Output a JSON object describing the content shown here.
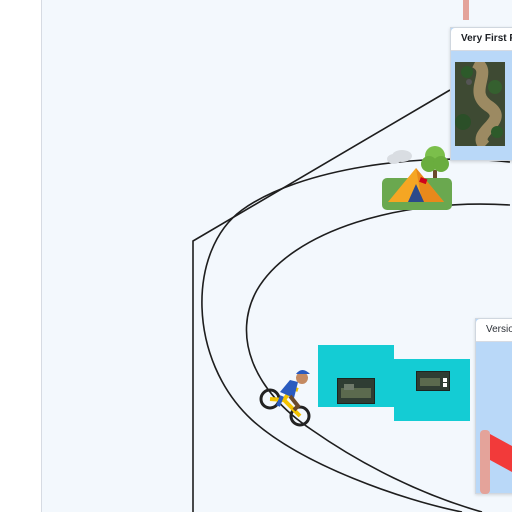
{
  "cards": [
    {
      "title": "Very First P"
    },
    {
      "title": "Versio"
    }
  ],
  "icons": {
    "tent": "camping-tent-icon",
    "cyclist": "mountain-biker-icon",
    "flag": "red-flag-icon",
    "tree": "tree-icon"
  },
  "colors": {
    "canvas": "#f3f8fd",
    "card": "#b9d8f8",
    "teal": "#14ccd4",
    "flag": "#f23a3a",
    "pole": "#e4a39a"
  }
}
